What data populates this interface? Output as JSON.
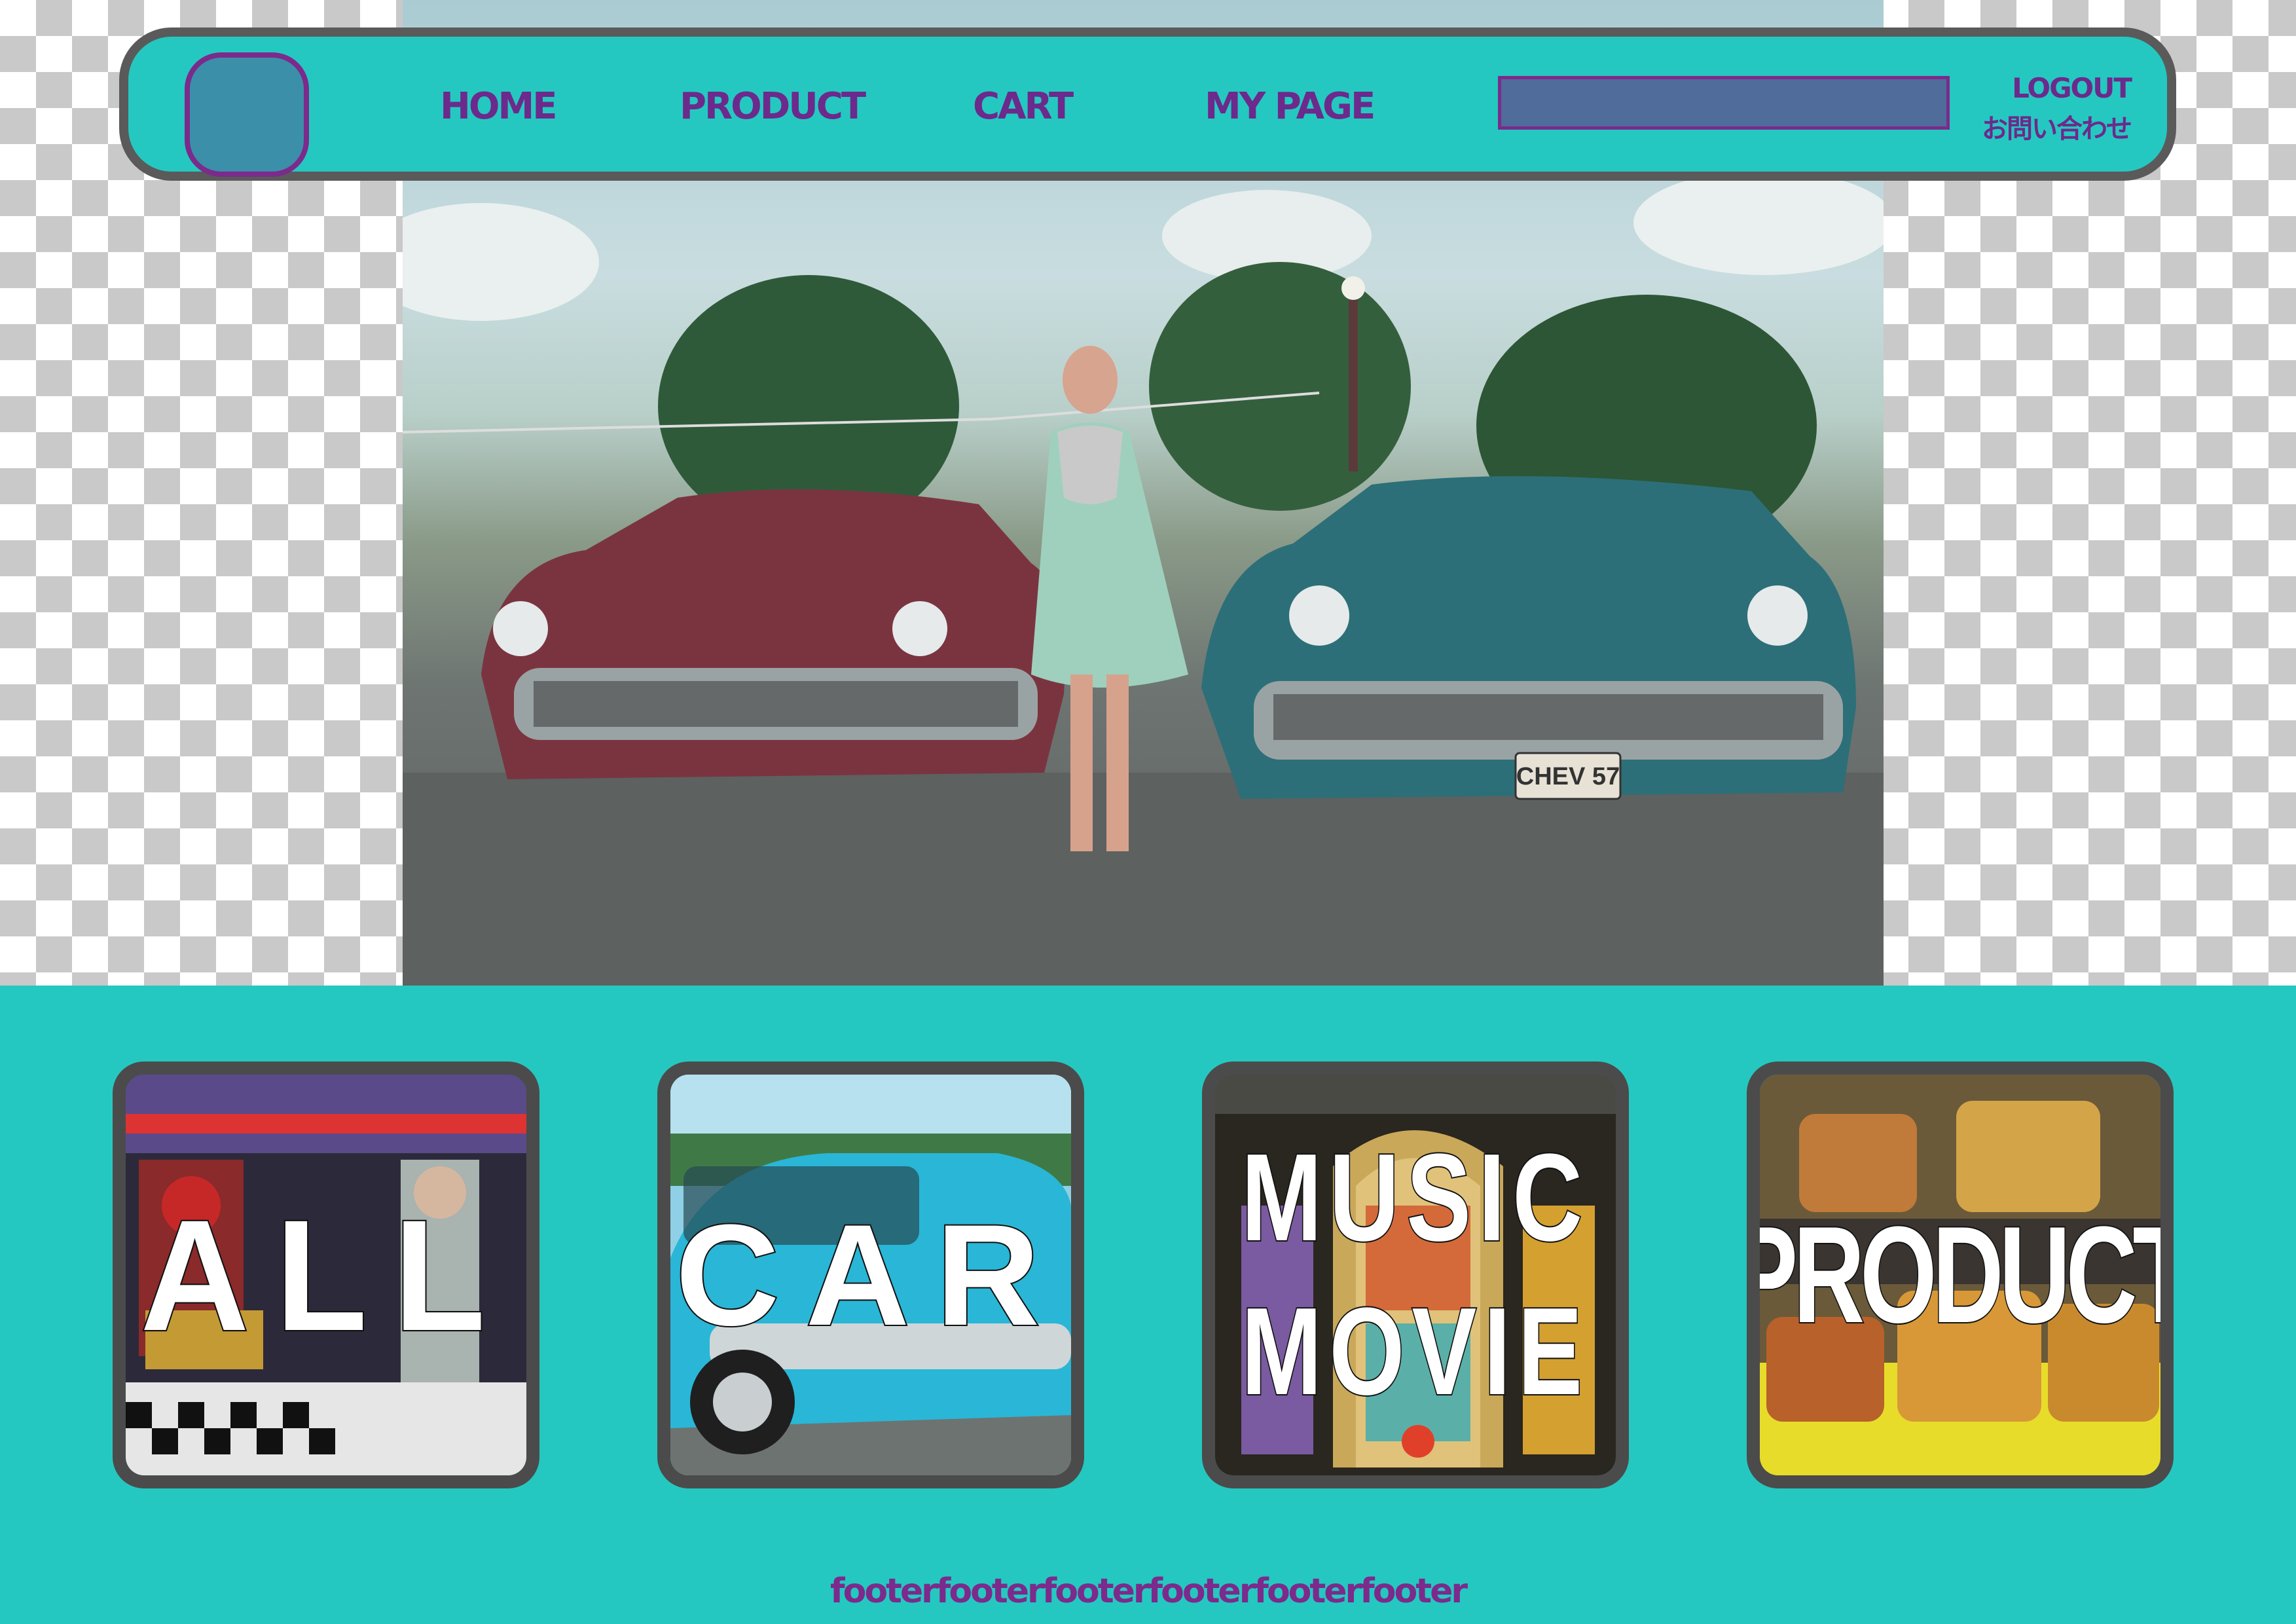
{
  "nav": {
    "home": "HOME",
    "product": "PRODUCT",
    "cart": "CART",
    "mypage": "MY PAGE",
    "logout": "LOGOUT",
    "contact": "お問い合わせ"
  },
  "search": {
    "value": "",
    "placeholder": ""
  },
  "hero": {
    "license_plate": "CHEV 57"
  },
  "categories": [
    {
      "label": "ALL"
    },
    {
      "label": "CAR"
    },
    {
      "label": "MUSIC\nMOVIE"
    },
    {
      "label": "PRODUCT"
    }
  ],
  "footer": {
    "text": "footerfooterfooterfooterfooterfooter"
  },
  "colors": {
    "teal": "#25c8c0",
    "purple": "#7c2a8c",
    "border_gray": "#5a5a5a",
    "search_fill": "#4f6c9a"
  }
}
